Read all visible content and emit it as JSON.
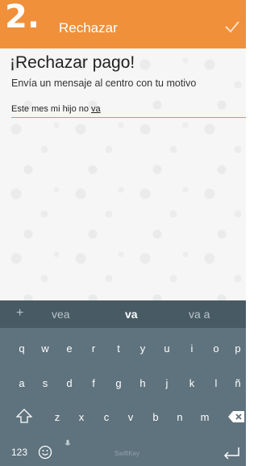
{
  "step_badge": "2.",
  "appbar": {
    "title": "Rechazar"
  },
  "content": {
    "title": "¡Rechazar pago!",
    "subtitle": "Envía un mensaje al centro con tu motivo",
    "message_text": "Este mes mi hijo no ",
    "message_last_word": "va"
  },
  "keyboard": {
    "suggestions": [
      "vea",
      "va",
      "va a"
    ],
    "row1": [
      "q",
      "w",
      "e",
      "r",
      "t",
      "y",
      "u",
      "i",
      "o",
      "p"
    ],
    "row2": [
      "a",
      "s",
      "d",
      "f",
      "g",
      "h",
      "j",
      "k",
      "l",
      "ñ"
    ],
    "row3": [
      "z",
      "x",
      "c",
      "v",
      "b",
      "n",
      "m"
    ],
    "num_label": "123",
    "brand": "SwiftKey"
  },
  "colors": {
    "accent": "#f0903a",
    "keyboard_bg": "#5f737e",
    "suggest_bg": "#485a64"
  },
  "icons": [
    "check-icon",
    "plus-icon",
    "shift-icon",
    "backspace-icon",
    "emoji-icon",
    "mic-icon",
    "enter-icon"
  ]
}
